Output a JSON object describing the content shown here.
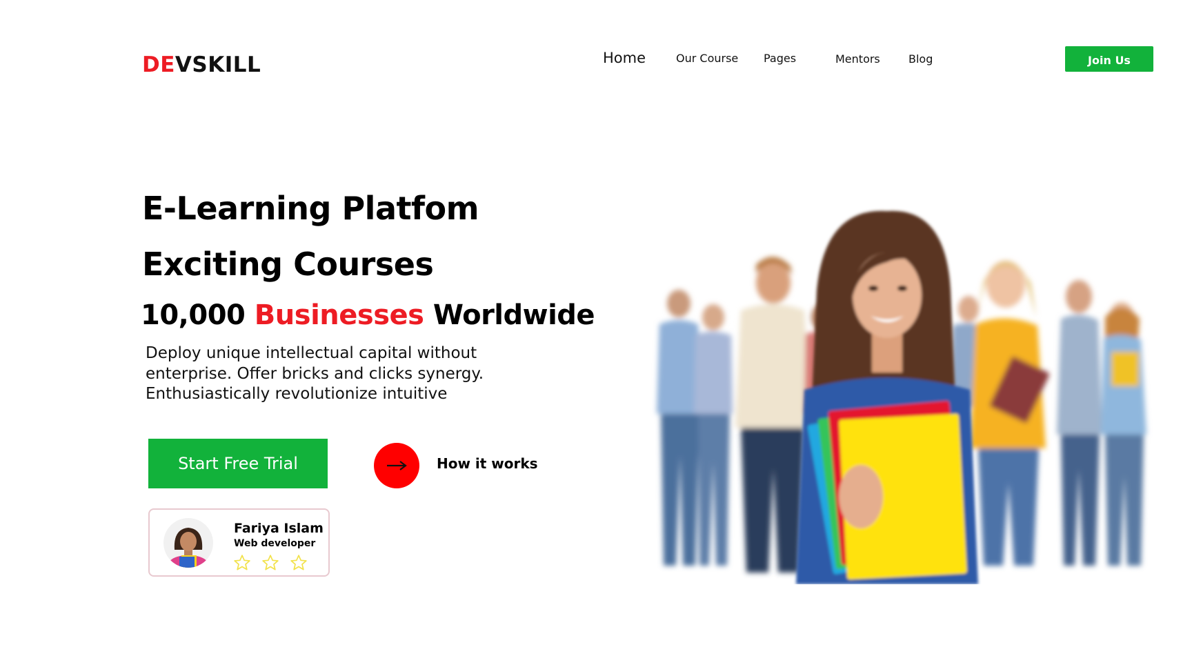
{
  "header": {
    "logo": {
      "part1": "DE",
      "part2": "VSKILL"
    },
    "nav": [
      {
        "label": "Home"
      },
      {
        "label": "Our Course"
      },
      {
        "label": "Pages"
      },
      {
        "label": "Mentors"
      },
      {
        "label": "Blog"
      }
    ],
    "join_label": "Join  Us"
  },
  "hero": {
    "title_line1": "E-Learning Platfom",
    "title_line2": "Exciting Courses",
    "stat": {
      "number": "10,000",
      "highlight": "Businesses",
      "suffix": "Worldwide"
    },
    "description_lines": [
      "Deploy unique intellectual capital without",
      "enterprise. Offer bricks and clicks synergy.",
      "Enthusiastically revolutionize intuitive"
    ],
    "cta_primary": "Start Free Trial",
    "cta_secondary": "How it works",
    "arrow_icon": "arrow-right-icon"
  },
  "profile_card": {
    "name": "Fariya Islam",
    "role": "Web developer",
    "rating": {
      "filled": 0,
      "total": 3
    }
  },
  "colors": {
    "brand_red": "#ed1c24",
    "cta_green": "#12b23b",
    "arrow_circle": "#ff0000",
    "star_outline": "#f2e24b"
  }
}
